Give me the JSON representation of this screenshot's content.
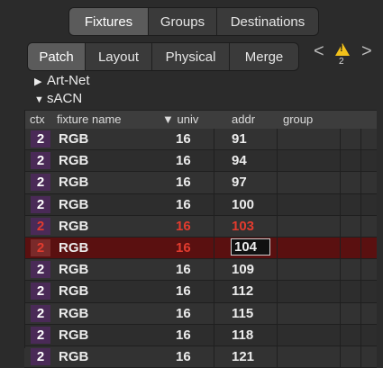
{
  "top_tabs": [
    "Fixtures",
    "Groups",
    "Destinations"
  ],
  "sub_tabs": [
    "Patch",
    "Layout",
    "Physical",
    "Merge"
  ],
  "nav": {
    "prev": "<",
    "next": ">"
  },
  "warning": {
    "symbol": "!",
    "count": "2",
    "color": "#f3c21b"
  },
  "tree": [
    {
      "label": "Art-Net",
      "expanded": false,
      "glyph": "▶"
    },
    {
      "label": "sACN",
      "expanded": true,
      "glyph": "▼"
    }
  ],
  "table": {
    "headers": [
      "ctx",
      "fixture name",
      "▼ univ",
      "addr",
      "group"
    ],
    "rows": [
      {
        "ctx": "2",
        "name": "RGB",
        "univ": "16",
        "addr": "91"
      },
      {
        "ctx": "2",
        "name": "RGB",
        "univ": "16",
        "addr": "94"
      },
      {
        "ctx": "2",
        "name": "RGB",
        "univ": "16",
        "addr": "97"
      },
      {
        "ctx": "2",
        "name": "RGB",
        "univ": "16",
        "addr": "100"
      },
      {
        "ctx": "2",
        "name": "RGB",
        "univ": "16",
        "addr": "103",
        "conflict": true
      },
      {
        "ctx": "2",
        "name": "RGB",
        "univ": "16",
        "addr": "104",
        "selected": true,
        "editing": true
      },
      {
        "ctx": "2",
        "name": "RGB",
        "univ": "16",
        "addr": "109"
      },
      {
        "ctx": "2",
        "name": "RGB",
        "univ": "16",
        "addr": "112"
      },
      {
        "ctx": "2",
        "name": "RGB",
        "univ": "16",
        "addr": "115"
      },
      {
        "ctx": "2",
        "name": "RGB",
        "univ": "16",
        "addr": "118"
      },
      {
        "ctx": "2",
        "name": "RGB",
        "univ": "16",
        "addr": "121"
      }
    ]
  },
  "colors": {
    "conflict": "#e23b2e",
    "selected_row": "#5a1010",
    "ctx_badge": "#4a2a57"
  }
}
